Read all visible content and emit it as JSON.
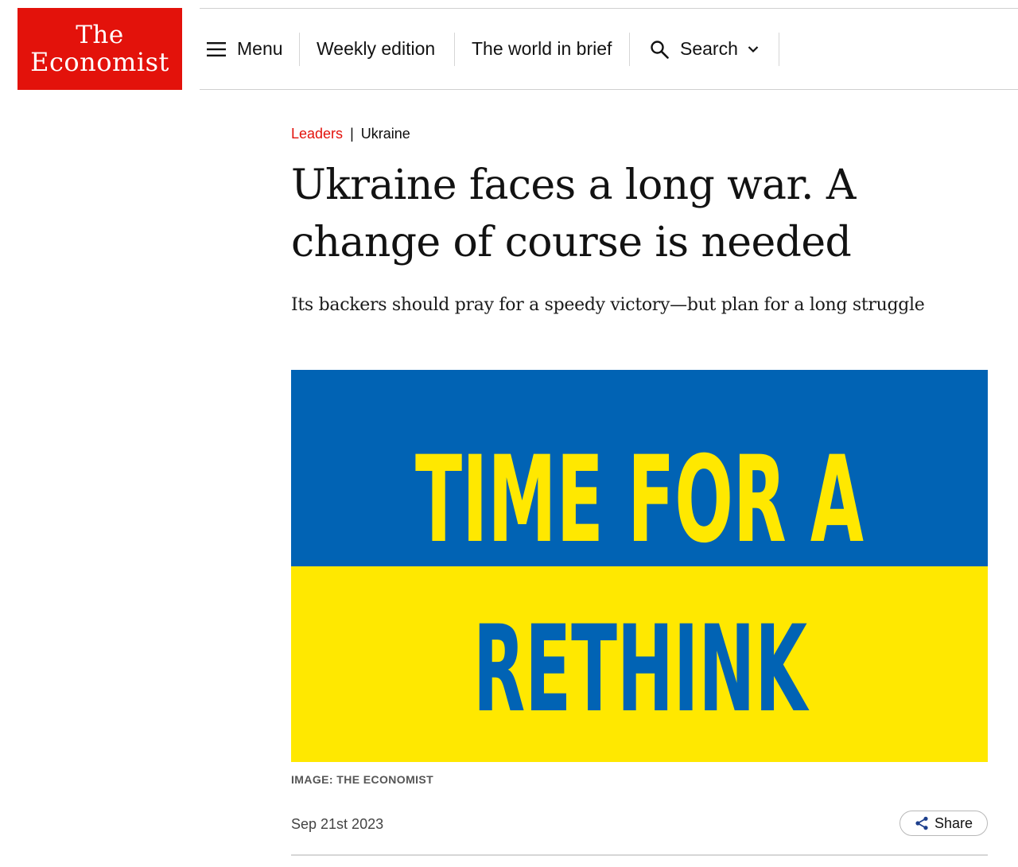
{
  "logo": {
    "line1": "The",
    "line2": "Economist"
  },
  "nav": {
    "menu_label": "Menu",
    "weekly_label": "Weekly edition",
    "brief_label": "The world in brief",
    "search_label": "Search"
  },
  "article": {
    "section": "Leaders",
    "separator": "|",
    "topic": "Ukraine",
    "headline": "Ukraine faces a long war. A change of course is needed",
    "standfirst": "Its backers should pray for a speedy victory—but plan for a long struggle",
    "hero_line1": "TIME FOR A",
    "hero_line2": "RETHINK",
    "image_caption": "IMAGE: THE ECONOMIST",
    "date": "Sep 21st 2023",
    "share_label": "Share"
  },
  "colors": {
    "brand_red": "#e3120b",
    "flag_blue": "#0163b4",
    "flag_yellow": "#ffe800"
  },
  "icons": [
    "menu-icon",
    "search-icon",
    "chevron-down-icon",
    "share-icon"
  ]
}
